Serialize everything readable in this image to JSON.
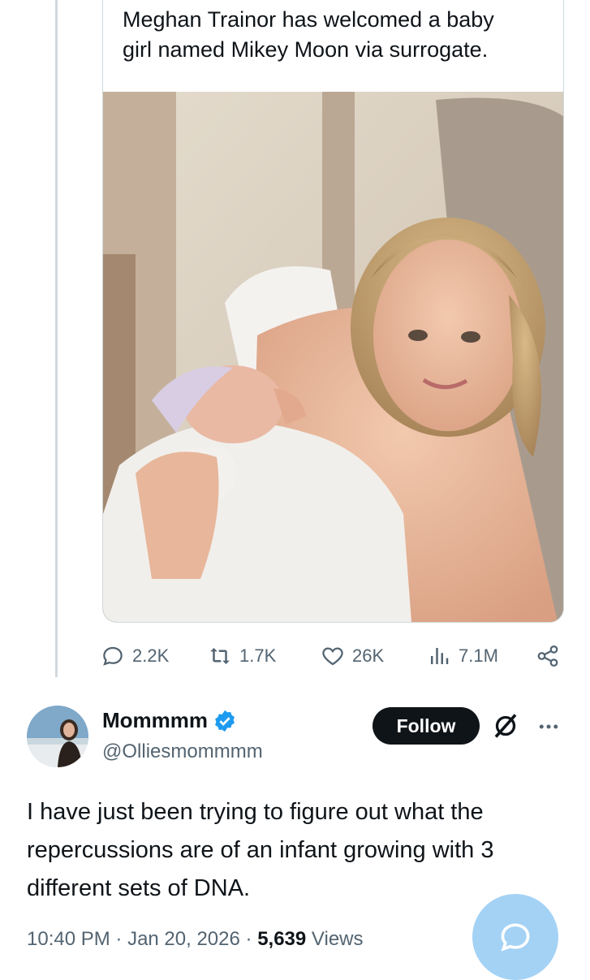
{
  "quoted_tweet": {
    "text_line1": "Meghan Trainor has welcomed a baby",
    "text_line2": "girl named Mikey Moon via surrogate.",
    "image_alt": "woman holding newborn wrapped in white towel"
  },
  "actions": {
    "replies": "2.2K",
    "reposts": "1.7K",
    "likes": "26K",
    "views": "7.1M"
  },
  "reply": {
    "name": "Mommmm",
    "handle": "@Olliesmommmm",
    "follow_label": "Follow",
    "text_line1": "I have just been trying to figure out what the",
    "text_line2": "repercussions are of an infant growing with 3",
    "text_line3": "different sets of DNA.",
    "time": "10:40 PM",
    "date": "Jan 20, 2026",
    "views_count": "5,639",
    "views_label": "Views",
    "separator": " · "
  },
  "colors": {
    "accent": "#1d9bf0",
    "secondary_text": "#536471",
    "fab": "#a4d2f5"
  },
  "icons": {
    "reply": "reply-icon",
    "repost": "repost-icon",
    "like": "heart-icon",
    "views": "analytics-icon",
    "share": "share-icon",
    "verified": "verified-badge-icon",
    "grok": "grok-icon",
    "more": "more-icon",
    "compose": "compose-reply-icon"
  }
}
